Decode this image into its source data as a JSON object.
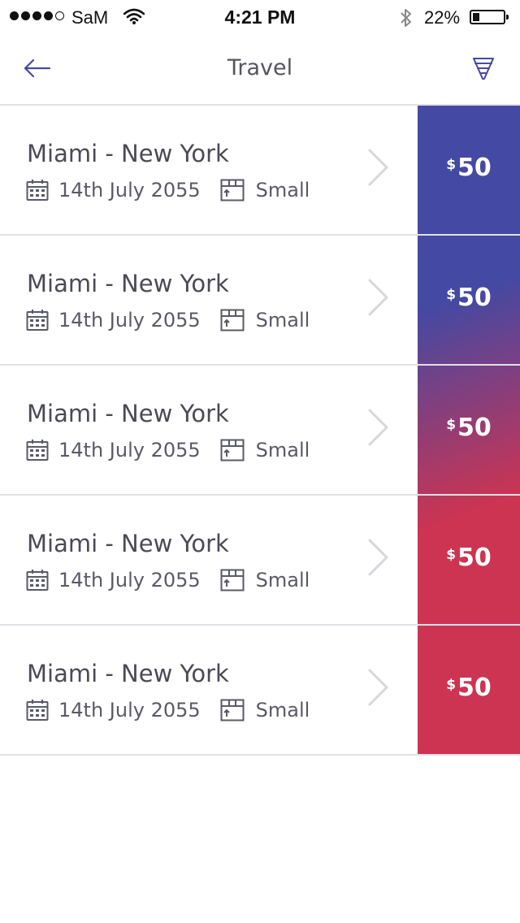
{
  "status_bar": {
    "carrier": "SaM",
    "time": "4:21 PM",
    "battery_percent": "22%",
    "battery_level": 0.22,
    "signal_bars": 4,
    "signal_total": 5
  },
  "nav": {
    "title": "Travel",
    "back_icon": "arrow-left-icon",
    "filter_icon": "filter-funnel-icon"
  },
  "colors": {
    "accent": "#4649a3",
    "gradient_top": "#4449a3",
    "gradient_bottom": "#cc3452",
    "text": "#4a4a55",
    "divider": "#e1e1e6"
  },
  "trips": [
    {
      "route": "Miami - New York",
      "date": "14th July 2055",
      "size": "Small",
      "currency": "$",
      "price": "50"
    },
    {
      "route": "Miami - New York",
      "date": "14th July 2055",
      "size": "Small",
      "currency": "$",
      "price": "50"
    },
    {
      "route": "Miami - New York",
      "date": "14th July 2055",
      "size": "Small",
      "currency": "$",
      "price": "50"
    },
    {
      "route": "Miami - New York",
      "date": "14th July 2055",
      "size": "Small",
      "currency": "$",
      "price": "50"
    },
    {
      "route": "Miami - New York",
      "date": "14th July 2055",
      "size": "Small",
      "currency": "$",
      "price": "50"
    }
  ]
}
